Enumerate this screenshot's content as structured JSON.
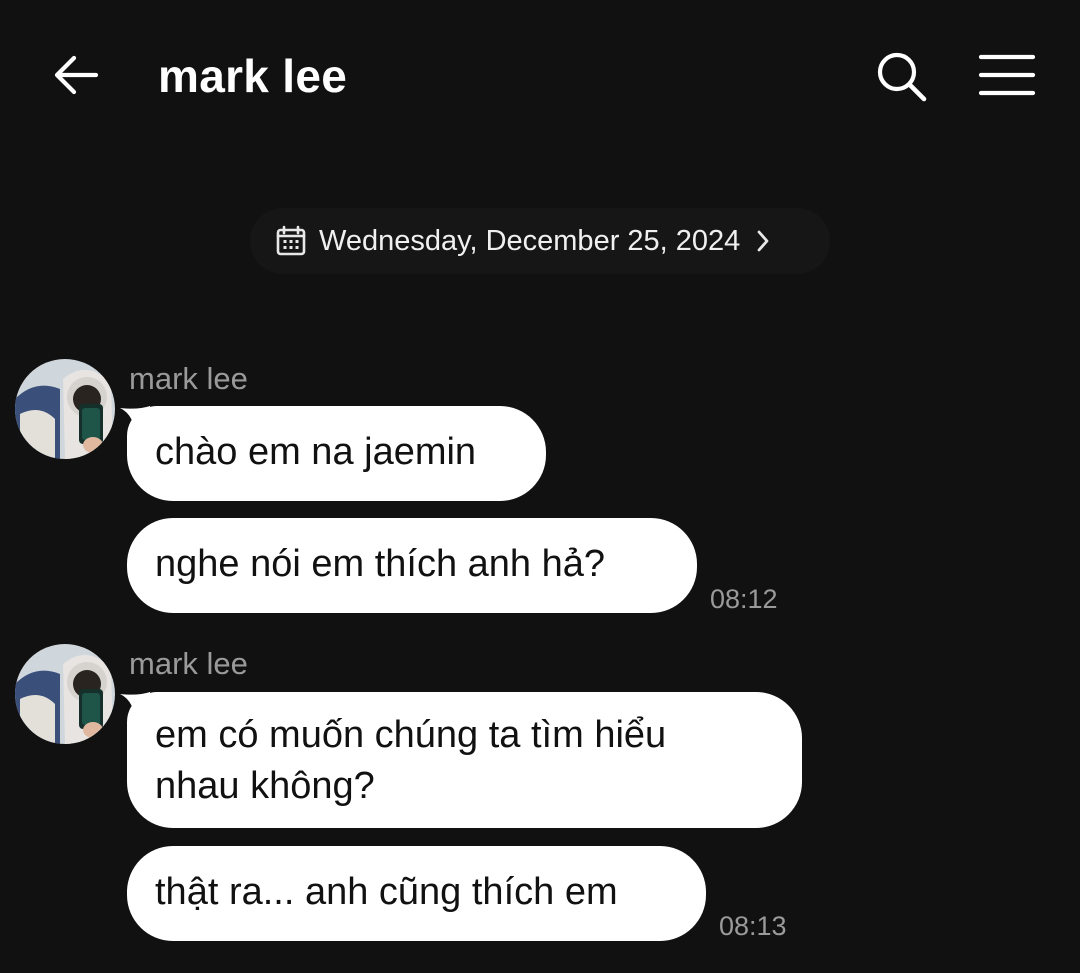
{
  "header": {
    "title": "mark lee",
    "back_icon": "arrow-left-icon",
    "search_icon": "search-icon",
    "menu_icon": "hamburger-menu-icon"
  },
  "date_separator": {
    "icon": "calendar-icon",
    "text": "Wednesday, December 25, 2024",
    "chevron_icon": "chevron-right-icon"
  },
  "groups": [
    {
      "sender": "mark lee",
      "avatar": "avatar",
      "messages": [
        {
          "text": "chào em na jaemin"
        },
        {
          "text": "nghe nói em thích anh hả?",
          "time": "08:12"
        }
      ]
    },
    {
      "sender": "mark lee",
      "avatar": "avatar",
      "messages": [
        {
          "text": "em có muốn chúng ta tìm hiểu\nnhau không?"
        },
        {
          "text": "thật ra... anh cũng thích em",
          "time": "08:13"
        }
      ]
    }
  ],
  "colors": {
    "background": "#111111",
    "bubble": "#ffffff",
    "bubble_text": "#111111",
    "muted": "#9a9a9a"
  }
}
